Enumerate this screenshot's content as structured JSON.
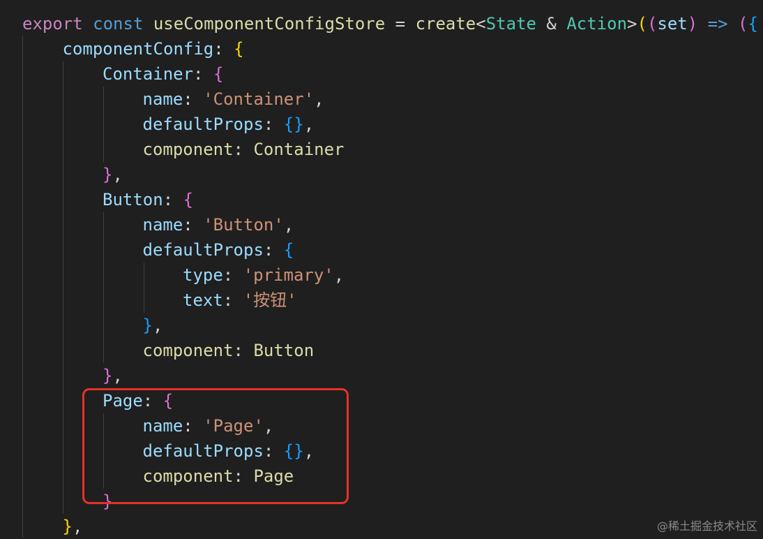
{
  "code": {
    "lines": [
      {
        "indent": 0,
        "tokens": [
          {
            "t": "export",
            "c": "keyword-purple"
          },
          {
            "t": " ",
            "c": "plain"
          },
          {
            "t": "const",
            "c": "keyword"
          },
          {
            "t": " ",
            "c": "plain"
          },
          {
            "t": "useComponentConfigStore",
            "c": "func"
          },
          {
            "t": " = ",
            "c": "plain"
          },
          {
            "t": "create",
            "c": "func"
          },
          {
            "t": "<",
            "c": "plain"
          },
          {
            "t": "State",
            "c": "type"
          },
          {
            "t": " & ",
            "c": "plain"
          },
          {
            "t": "Action",
            "c": "type"
          },
          {
            "t": ">",
            "c": "plain"
          },
          {
            "t": "(",
            "c": "brace-1"
          },
          {
            "t": "(",
            "c": "brace-2"
          },
          {
            "t": "set",
            "c": "var"
          },
          {
            "t": ")",
            "c": "brace-2"
          },
          {
            "t": " ",
            "c": "plain"
          },
          {
            "t": "=>",
            "c": "keyword"
          },
          {
            "t": " ",
            "c": "plain"
          },
          {
            "t": "(",
            "c": "brace-2"
          },
          {
            "t": "{",
            "c": "brace-3"
          }
        ]
      },
      {
        "indent": 1,
        "tokens": [
          {
            "t": "componentConfig",
            "c": "prop"
          },
          {
            "t": ": ",
            "c": "plain"
          },
          {
            "t": "{",
            "c": "brace-1"
          }
        ]
      },
      {
        "indent": 2,
        "tokens": [
          {
            "t": "Container",
            "c": "prop"
          },
          {
            "t": ": ",
            "c": "plain"
          },
          {
            "t": "{",
            "c": "brace-2"
          }
        ]
      },
      {
        "indent": 3,
        "tokens": [
          {
            "t": "name",
            "c": "prop"
          },
          {
            "t": ": ",
            "c": "plain"
          },
          {
            "t": "'Container'",
            "c": "string"
          },
          {
            "t": ",",
            "c": "plain"
          }
        ]
      },
      {
        "indent": 3,
        "tokens": [
          {
            "t": "defaultProps",
            "c": "prop"
          },
          {
            "t": ": ",
            "c": "plain"
          },
          {
            "t": "{}",
            "c": "brace-3"
          },
          {
            "t": ",",
            "c": "plain"
          }
        ]
      },
      {
        "indent": 3,
        "tokens": [
          {
            "t": "component",
            "c": "prop-yellow"
          },
          {
            "t": ": ",
            "c": "plain"
          },
          {
            "t": "Container",
            "c": "func"
          }
        ]
      },
      {
        "indent": 2,
        "tokens": [
          {
            "t": "}",
            "c": "brace-2"
          },
          {
            "t": ",",
            "c": "plain"
          }
        ]
      },
      {
        "indent": 2,
        "tokens": [
          {
            "t": "Button",
            "c": "prop"
          },
          {
            "t": ": ",
            "c": "plain"
          },
          {
            "t": "{",
            "c": "brace-2"
          }
        ]
      },
      {
        "indent": 3,
        "tokens": [
          {
            "t": "name",
            "c": "prop"
          },
          {
            "t": ": ",
            "c": "plain"
          },
          {
            "t": "'Button'",
            "c": "string"
          },
          {
            "t": ",",
            "c": "plain"
          }
        ]
      },
      {
        "indent": 3,
        "tokens": [
          {
            "t": "defaultProps",
            "c": "prop"
          },
          {
            "t": ": ",
            "c": "plain"
          },
          {
            "t": "{",
            "c": "brace-3"
          }
        ]
      },
      {
        "indent": 4,
        "tokens": [
          {
            "t": "type",
            "c": "prop"
          },
          {
            "t": ": ",
            "c": "plain"
          },
          {
            "t": "'primary'",
            "c": "string"
          },
          {
            "t": ",",
            "c": "plain"
          }
        ]
      },
      {
        "indent": 4,
        "tokens": [
          {
            "t": "text",
            "c": "prop"
          },
          {
            "t": ": ",
            "c": "plain"
          },
          {
            "t": "'按钮'",
            "c": "string"
          }
        ]
      },
      {
        "indent": 3,
        "tokens": [
          {
            "t": "}",
            "c": "brace-3"
          },
          {
            "t": ",",
            "c": "plain"
          }
        ]
      },
      {
        "indent": 3,
        "tokens": [
          {
            "t": "component",
            "c": "prop-yellow"
          },
          {
            "t": ": ",
            "c": "plain"
          },
          {
            "t": "Button",
            "c": "func"
          }
        ]
      },
      {
        "indent": 2,
        "tokens": [
          {
            "t": "}",
            "c": "brace-2"
          },
          {
            "t": ",",
            "c": "plain"
          }
        ]
      },
      {
        "indent": 2,
        "tokens": [
          {
            "t": "Page",
            "c": "prop"
          },
          {
            "t": ": ",
            "c": "plain"
          },
          {
            "t": "{",
            "c": "brace-2"
          }
        ]
      },
      {
        "indent": 3,
        "tokens": [
          {
            "t": "name",
            "c": "prop"
          },
          {
            "t": ": ",
            "c": "plain"
          },
          {
            "t": "'Page'",
            "c": "string"
          },
          {
            "t": ",",
            "c": "plain"
          }
        ]
      },
      {
        "indent": 3,
        "tokens": [
          {
            "t": "defaultProps",
            "c": "prop"
          },
          {
            "t": ": ",
            "c": "plain"
          },
          {
            "t": "{}",
            "c": "brace-3"
          },
          {
            "t": ",",
            "c": "plain"
          }
        ]
      },
      {
        "indent": 3,
        "tokens": [
          {
            "t": "component",
            "c": "prop-yellow"
          },
          {
            "t": ": ",
            "c": "plain"
          },
          {
            "t": "Page",
            "c": "func"
          }
        ]
      },
      {
        "indent": 2,
        "tokens": [
          {
            "t": "}",
            "c": "brace-2"
          }
        ]
      },
      {
        "indent": 1,
        "tokens": [
          {
            "t": "}",
            "c": "brace-1"
          },
          {
            "t": ",",
            "c": "plain"
          }
        ]
      }
    ]
  },
  "watermark": "@稀土掘金技术社区",
  "colors": {
    "background": "#1f1f1f",
    "highlight_border": "#e53228"
  }
}
